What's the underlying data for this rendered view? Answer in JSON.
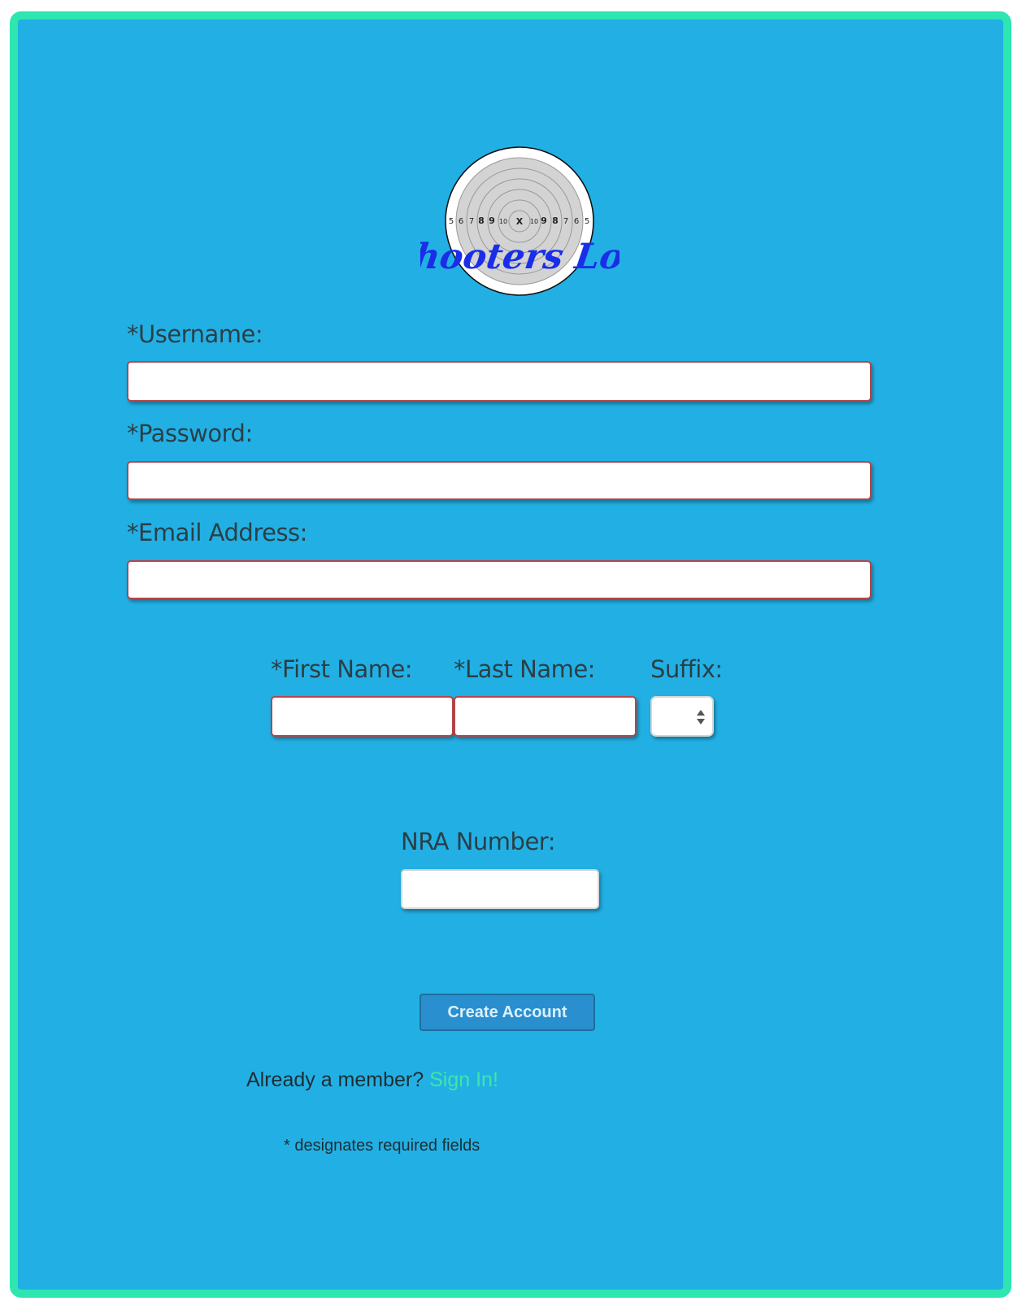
{
  "logo": {
    "text": "Shooters Log",
    "ring_numbers_left": [
      "5",
      "6",
      "7",
      "8",
      "9",
      "10"
    ],
    "center": "X",
    "ring_numbers_right": [
      "10",
      "9",
      "8",
      "7",
      "6",
      "5"
    ]
  },
  "form": {
    "username_label": "*Username:",
    "username_value": "",
    "password_label": "*Password:",
    "password_value": "",
    "email_label": "*Email Address:",
    "email_value": "",
    "first_name_label": "*First Name:",
    "first_name_value": "",
    "last_name_label": "*Last Name:",
    "last_name_value": "",
    "suffix_label": "Suffix:",
    "suffix_value": "",
    "nra_label": "NRA Number:",
    "nra_value": ""
  },
  "actions": {
    "create_account": "Create Account",
    "already_member": "Already a member?",
    "sign_in": "Sign In!"
  },
  "footnote": "* designates required fields",
  "colors": {
    "frame_border": "#2ee6b0",
    "background": "#22b0e4",
    "logo_text": "#1a2ee8",
    "link": "#3fe6a6",
    "required_border": "#b3464a"
  }
}
